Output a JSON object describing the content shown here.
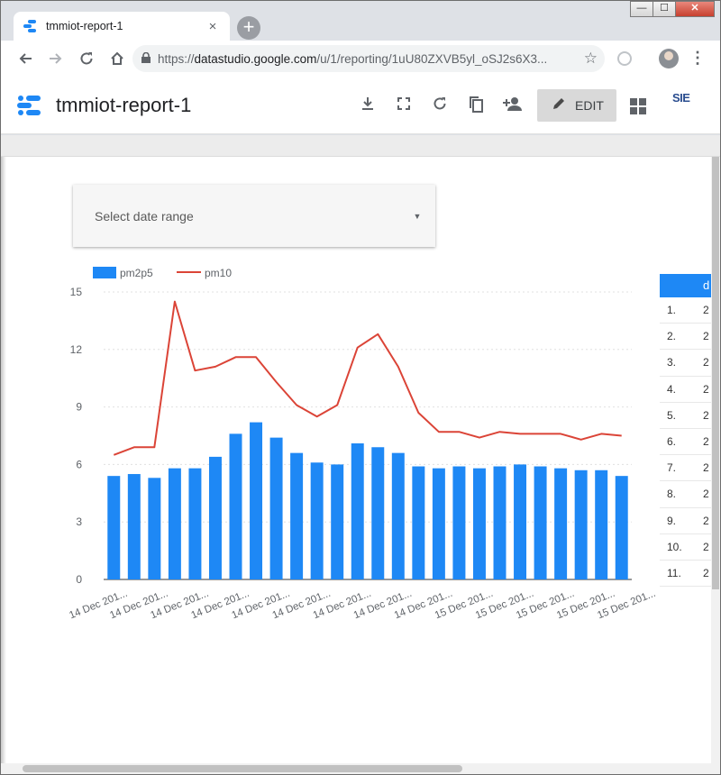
{
  "browser": {
    "tab_title": "tmmiot-report-1",
    "tab_close": "×",
    "new_tab": "+",
    "url_host": "datastudio.google.com",
    "url_prefix": "https://",
    "url_path": "/u/1/reporting/1uU80ZXVB5yl_oSJ2s6X3...",
    "window_controls": [
      "—",
      "☐",
      "✕"
    ]
  },
  "report": {
    "title": "tmmiot-report-1",
    "edit_label": "EDIT",
    "brand_text": "SIE"
  },
  "date_control": {
    "label": "Select date range",
    "caret": "▼"
  },
  "chart_data": {
    "type": "bar",
    "series": [
      {
        "name": "pm2p5",
        "type": "bar",
        "color": "#1e88f5",
        "values": [
          5.4,
          5.5,
          5.3,
          5.8,
          5.8,
          6.4,
          7.6,
          8.2,
          7.4,
          6.6,
          6.1,
          6.0,
          7.1,
          6.9,
          6.6,
          5.9,
          5.8,
          5.9,
          5.8,
          5.9,
          6.0,
          5.9,
          5.8,
          5.7,
          5.7,
          5.4
        ]
      },
      {
        "name": "pm10",
        "type": "line",
        "color": "#db4437",
        "values": [
          6.5,
          6.9,
          6.9,
          14.5,
          10.9,
          11.1,
          11.6,
          11.6,
          10.3,
          9.1,
          8.5,
          9.1,
          12.1,
          12.8,
          11.1,
          8.7,
          7.7,
          7.7,
          7.4,
          7.7,
          7.6,
          7.6,
          7.6,
          7.3,
          7.6,
          7.5
        ]
      }
    ],
    "x_tick_labels": [
      "14 Dec 201...",
      "14 Dec 201...",
      "14 Dec 201...",
      "14 Dec 201...",
      "14 Dec 201...",
      "14 Dec 201...",
      "14 Dec 201...",
      "14 Dec 201...",
      "14 Dec 201...",
      "15 Dec 201...",
      "15 Dec 201...",
      "15 Dec 201...",
      "15 Dec 201...",
      "15 Dec 201..."
    ],
    "y_ticks": [
      0,
      3,
      6,
      9,
      12,
      15
    ],
    "ylim": [
      0,
      15
    ],
    "legend_position": "top-left",
    "grid": true
  },
  "table": {
    "header": "d",
    "rows": [
      {
        "idx": "1.",
        "val": "2"
      },
      {
        "idx": "2.",
        "val": "2"
      },
      {
        "idx": "3.",
        "val": "2"
      },
      {
        "idx": "4.",
        "val": "2"
      },
      {
        "idx": "5.",
        "val": "2"
      },
      {
        "idx": "6.",
        "val": "2"
      },
      {
        "idx": "7.",
        "val": "2"
      },
      {
        "idx": "8.",
        "val": "2"
      },
      {
        "idx": "9.",
        "val": "2"
      },
      {
        "idx": "10.",
        "val": "2"
      },
      {
        "idx": "11.",
        "val": "2"
      }
    ]
  }
}
